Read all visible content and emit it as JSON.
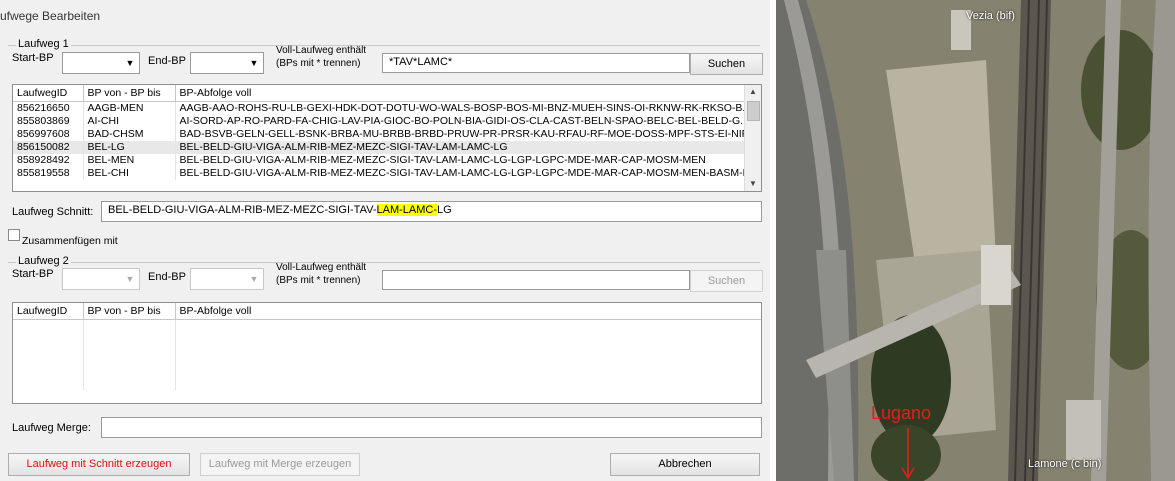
{
  "window": {
    "title": "ufwege Bearbeiten"
  },
  "laufweg1": {
    "group_label": "Laufweg 1",
    "start_label": "Start-BP",
    "end_label": "End-BP",
    "voll_label_line1": "Voll-Laufweg enthält",
    "voll_label_line2": "(BPs mit * trennen)",
    "voll_value": "*TAV*LAMC*",
    "search_button": "Suchen",
    "columns": [
      "LaufwegID",
      "BP von - BP bis",
      "BP-Abfolge voll"
    ],
    "rows": [
      [
        "856216650",
        "AAGB-MEN",
        "AAGB-AAO-ROHS-RU-LB-GEXI-HDK-DOT-DOTU-WO-WALS-BOSP-BOS-MI-BNZ-MUEH-SINS-OI-RKNW-RK-RKSO-B..."
      ],
      [
        "855803869",
        "AI-CHI",
        "AI-SORD-AP-RO-PARD-FA-CHIG-LAV-PIA-GIOC-BO-POLN-BIA-GIDI-OS-CLA-CAST-BELN-SPAO-BELC-BEL-BELD-G..."
      ],
      [
        "856997608",
        "BAD-CHSM",
        "BAD-BSVB-GELN-GELL-BSNK-BRBA-MU-BRBB-BRBD-PRUW-PR-PRSR-KAU-RFAU-RF-MOE-DOSS-MPF-STS-EI-NIF-F..."
      ],
      [
        "856150082",
        "BEL-LG",
        "BEL-BELD-GIU-VIGA-ALM-RIB-MEZ-MEZC-SIGI-TAV-LAM-LAMC-LG"
      ],
      [
        "858928492",
        "BEL-MEN",
        "BEL-BELD-GIU-VIGA-ALM-RIB-MEZ-MEZC-SIGI-TAV-LAM-LAMC-LG-LGP-LGPC-MDE-MAR-CAP-MOSM-MEN"
      ],
      [
        "855819558",
        "BEL-CHI",
        "BEL-BELD-GIU-VIGA-ALM-RIB-MEZ-MEZC-SIGI-TAV-LAM-LAMC-LG-LGP-LGPC-MDE-MAR-CAP-MOSM-MEN-BASM-B..."
      ]
    ],
    "schnitt_label": "Laufweg Schnitt:",
    "schnitt_before": "BEL-BELD-GIU-VIGA-ALM-RIB-MEZ-MEZC-SIGI-TAV-",
    "schnitt_highlight": "LAM-LAMC-",
    "schnitt_after": "LG"
  },
  "merge_checkbox_label": "Zusammenfügen mit",
  "laufweg2": {
    "group_label": "Laufweg 2",
    "start_label": "Start-BP",
    "end_label": "End-BP",
    "voll_label_line1": "Voll-Laufweg enthält",
    "voll_label_line2": "(BPs mit * trennen)",
    "voll_value": "",
    "search_button": "Suchen",
    "columns": [
      "LaufwegID",
      "BP von - BP bis",
      "BP-Abfolge voll"
    ]
  },
  "merge_label": "Laufweg Merge:",
  "buttons": {
    "create_schnitt": "Laufweg mit Schnitt erzeugen",
    "create_merge": "Laufweg mit Merge erzeugen",
    "cancel": "Abbrechen"
  },
  "map": {
    "label_top": "Vezia (bif)",
    "label_lugano": "Lugano",
    "label_bottom": "Lamone (c bin)",
    "lugano_color": "#e0201a"
  }
}
